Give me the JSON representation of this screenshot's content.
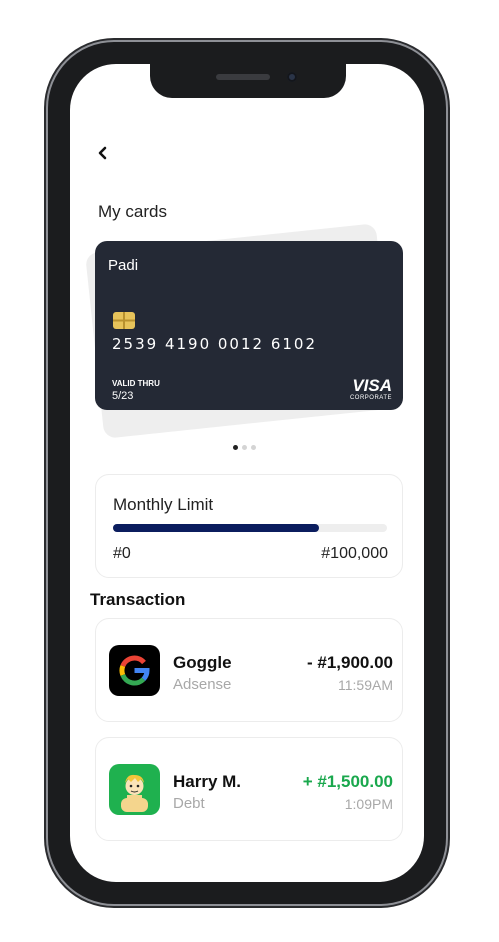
{
  "header": {
    "back_icon": "chevron-left-icon"
  },
  "cards": {
    "title": "My cards",
    "card": {
      "holder": "Padi",
      "number": "2539 4190 0012 6102",
      "valid_label": "VALID THRU",
      "valid_value": "5/23",
      "brand": "VISA",
      "brand_sub": "CORPORATE",
      "color": "#242935"
    },
    "pager": {
      "count": 3,
      "active": 1
    }
  },
  "limit": {
    "title": "Monthly Limit",
    "min": "#0",
    "max": "#100,000",
    "progress": 0.75,
    "bar_color": "#0b1d5e"
  },
  "transactions": {
    "title": "Transaction",
    "items": [
      {
        "name": "Goggle",
        "sub": "Adsense",
        "amount": "- #1,900.00",
        "time": "11:59AM",
        "amount_color": "#111111",
        "icon": "google-logo-icon"
      },
      {
        "name": "Harry M.",
        "sub": "Debt",
        "amount": "+ #1,500.00",
        "time": "1:09PM",
        "amount_color": "#1aa84d",
        "icon": "user-avatar-icon"
      }
    ]
  }
}
